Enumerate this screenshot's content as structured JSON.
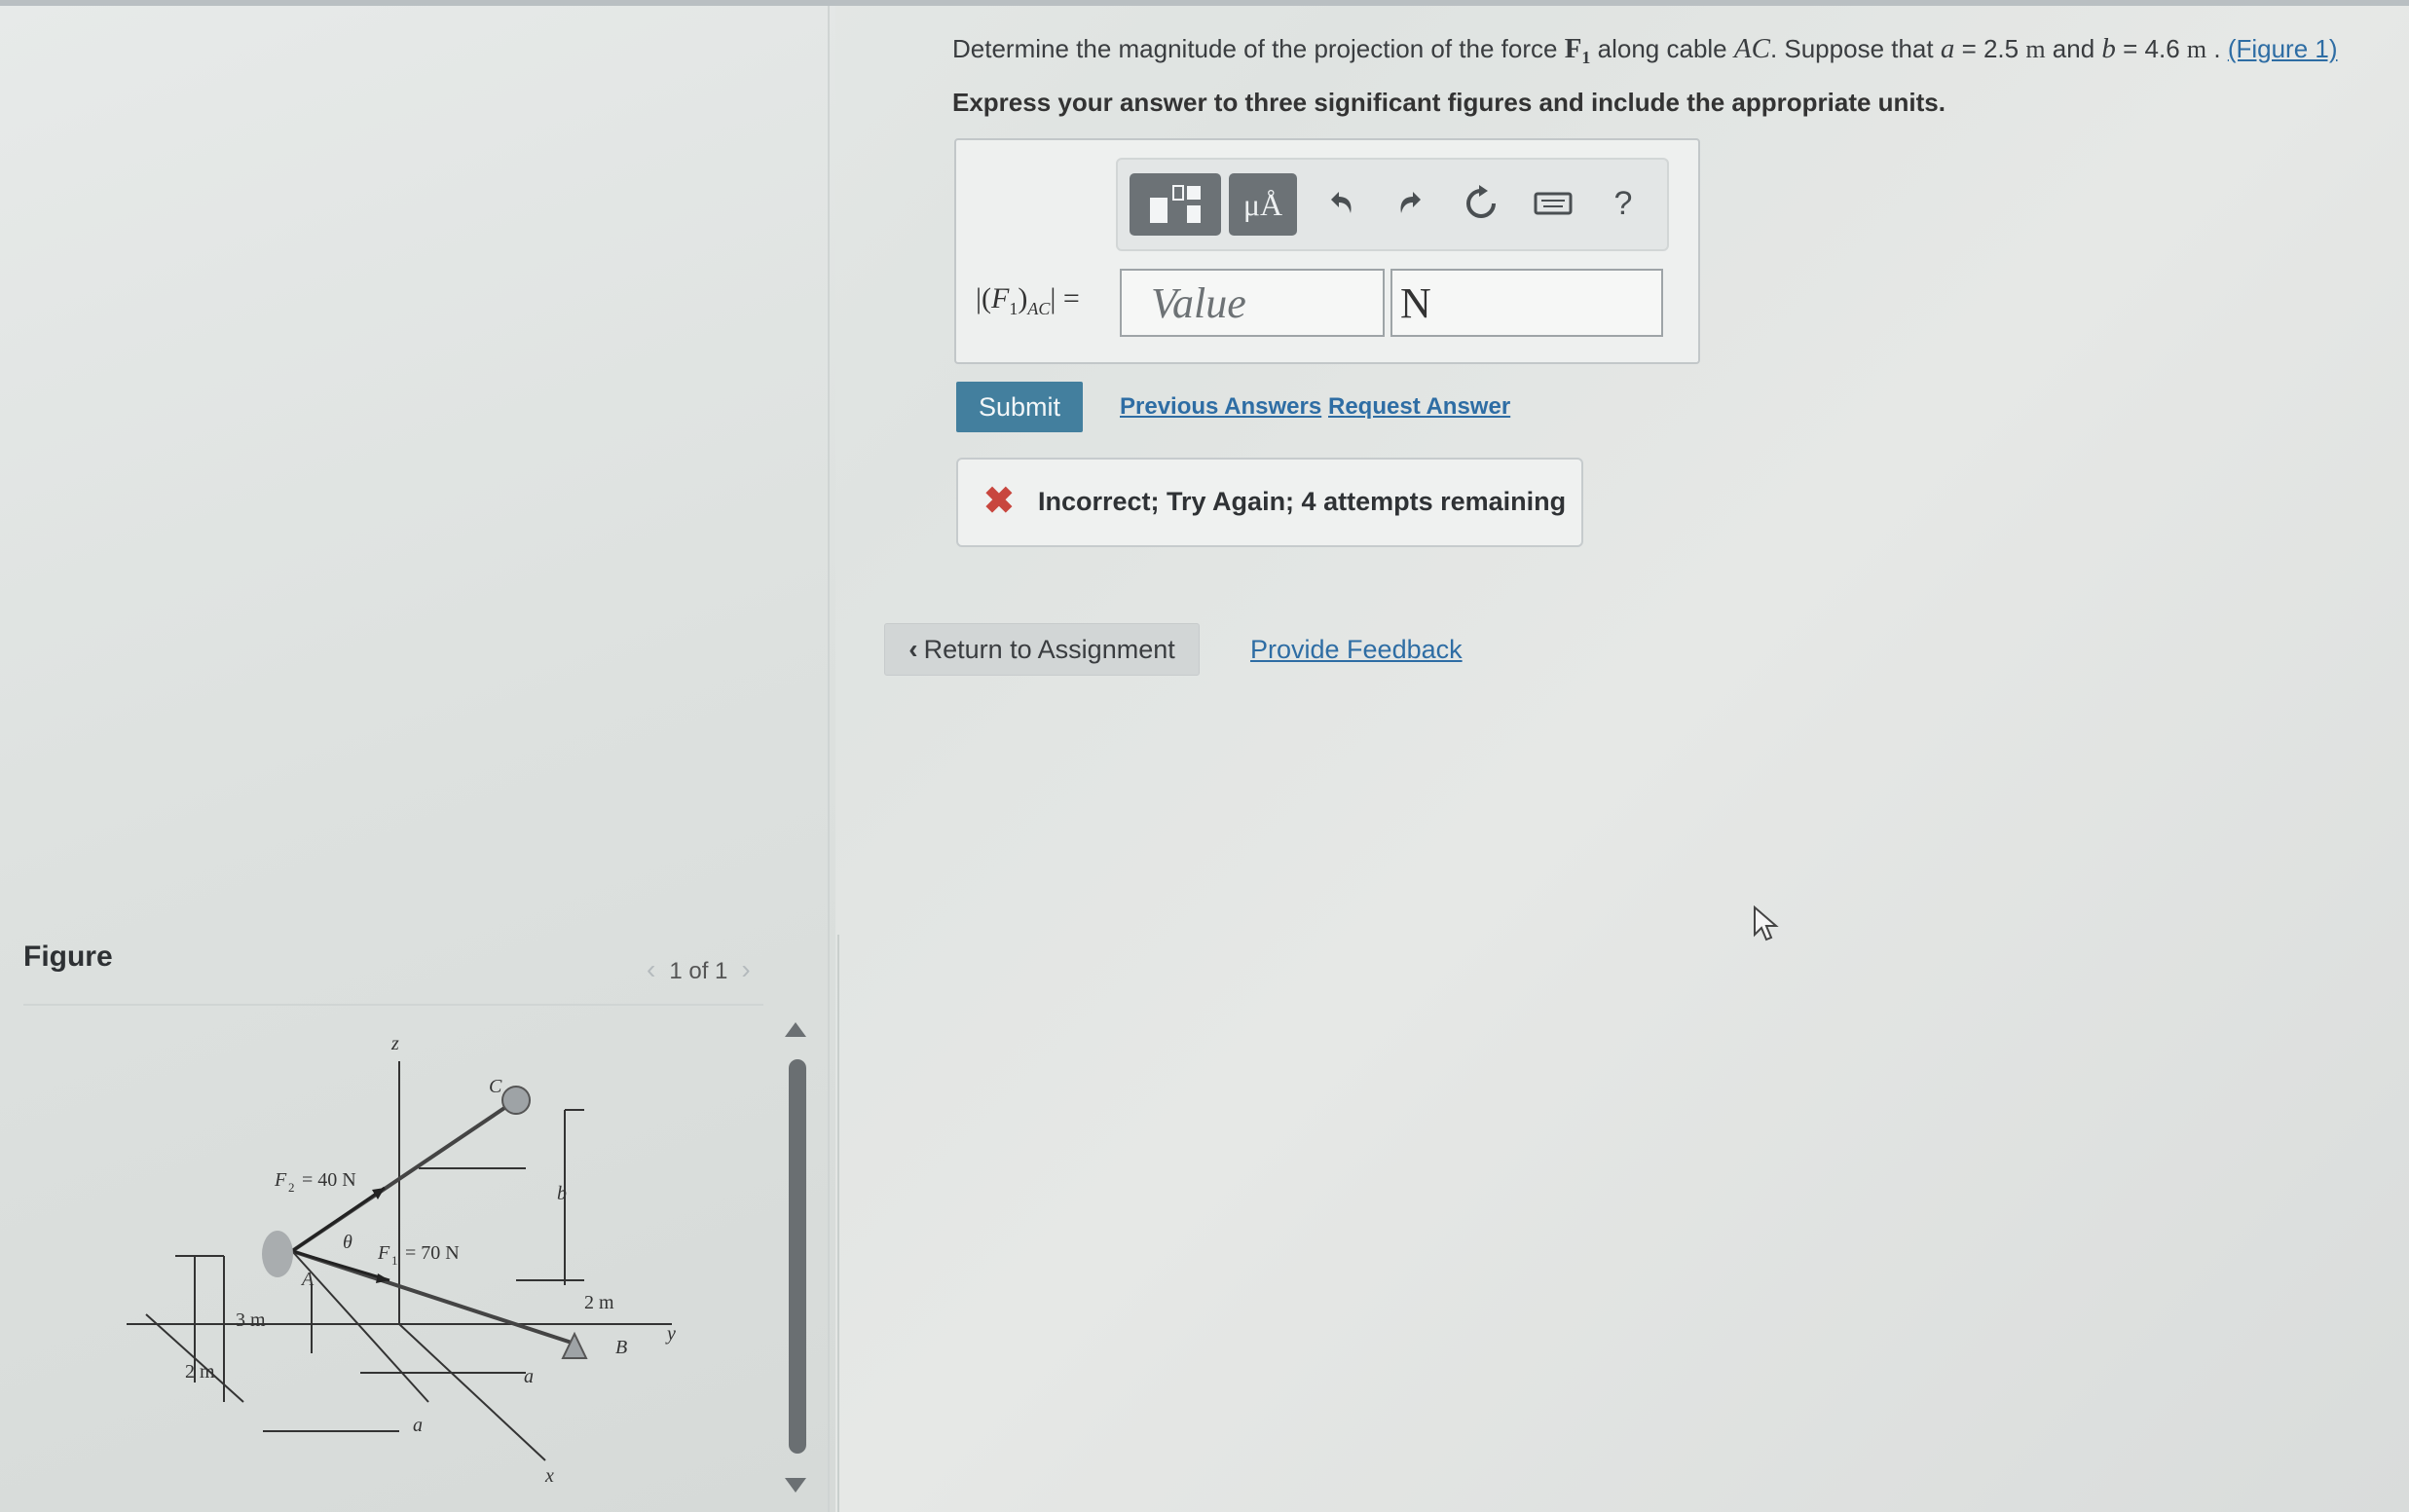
{
  "question": {
    "text_part1": "Determine the magnitude of the projection of the force ",
    "force": "F",
    "force_sub": "1",
    "text_part2": " along cable ",
    "cable": "AC",
    "text_part3": ". Suppose that ",
    "a_var": "a",
    "a_eq": " = 2.5 ",
    "a_unit": "m",
    "and_text": " and ",
    "b_var": "b",
    "b_eq": " = 4.6 ",
    "b_unit": "m",
    "sep": " . ",
    "figure_link": "(Figure 1)",
    "instruction": "Express your answer to three significant figures and include the appropriate units."
  },
  "toolbar": {
    "templates_icon": "templates-icon",
    "units_label": "μÅ",
    "undo_icon": "undo-icon",
    "redo_icon": "redo-icon",
    "reset_icon": "reset-icon",
    "keyboard_icon": "keyboard-icon",
    "help_label": "?"
  },
  "answer": {
    "label_prefix": "|(",
    "label_var": "F",
    "label_sub": "1",
    "label_close": ")",
    "label_subscript": "AC",
    "label_suffix": "| =",
    "value_placeholder": "Value",
    "unit_value": "N"
  },
  "actions": {
    "submit": "Submit",
    "previous_answers": "Previous Answers",
    "request_answer": "Request Answer"
  },
  "feedback": {
    "message": "Incorrect; Try Again; 4 attempts remaining",
    "status_color": "#c8463e"
  },
  "nav": {
    "return_label": "Return to Assignment",
    "provide_feedback": "Provide Feedback"
  },
  "figure": {
    "heading": "Figure",
    "pager": "1 of 1",
    "labels": {
      "z": "z",
      "c": "C",
      "f2": "F",
      "f2_sub": "2",
      "f2_val": " = 40 N",
      "theta": "θ",
      "f1": "F",
      "f1_sub": "1",
      "f1_val": " = 70 N",
      "a_point": "A",
      "b_dim": "b",
      "three_m": "3 m",
      "two_m_left": "2 m",
      "two_m_right": "2 m",
      "b_point": "B",
      "y": "y",
      "a_dim1": "a",
      "a_dim2": "a",
      "x": "x"
    }
  }
}
